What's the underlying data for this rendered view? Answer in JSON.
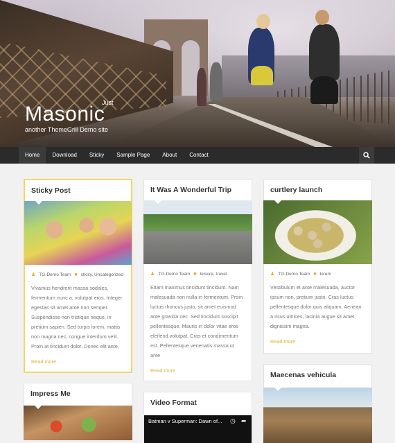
{
  "site": {
    "title": "Masonic",
    "description": "another ThemeGrill Demo site",
    "hero_extra": "Just"
  },
  "nav": {
    "items": [
      "Home",
      "Download",
      "Sticky",
      "Sample Page",
      "About",
      "Contact"
    ],
    "active": "Home",
    "search_icon": "search-icon"
  },
  "colors": {
    "accent": "#e0b02e",
    "sticky_border": "#f5d46a",
    "nav_bg": "#2b2b2b"
  },
  "posts": {
    "sticky": {
      "title": "Sticky Post",
      "author": "TG-Demo Team",
      "categories": "sticky, Uncategorized",
      "excerpt": "Vivamus hendrerit massa sodales, fermentum nunc a, volutpat eros. Integer egestas sit amet ante non semper. Suspendisse non tristique neque, in pretium sapien. Sed turpis lorem, mattis non magna nec, congue interdum velit. Proin at tincidunt dolor. Donec elit ante,",
      "read_more": "Read more"
    },
    "wonderful": {
      "title": "It Was A Wonderful Trip",
      "author": "TG-Demo Team",
      "categories": "leisure, travel",
      "excerpt": "Etiam maximus tincidunt tincidunt. Nam malesuada non nulla in fermentum. Proin luctus rhoncus justo, sit amet euismod ante gravida nec. Sed tincidunt suscipit pellentesque. Mauris in dolor vitae eros eleifend volutpat. Cras et condimentum est. Pellentesque venenatis massa ut ante",
      "read_more": "Read more"
    },
    "curtlery": {
      "title": "curtlery launch",
      "author": "TG-Demo Team",
      "categories": "lorem",
      "excerpt": "Vestibulum et ante malesuada, auctor ipsum non, pretium justo. Cras luctus pellentesque dolor quis aliquam. Aenean a risus ultrices, lacinia augue sit amet, dignissim magna.",
      "read_more": "Read more"
    },
    "impress": {
      "title": "Impress Me"
    },
    "video": {
      "title": "Video Format",
      "video_title": "Batman v Superman: Dawn of..."
    },
    "maecenas": {
      "title": "Maecenas vehicula"
    }
  }
}
